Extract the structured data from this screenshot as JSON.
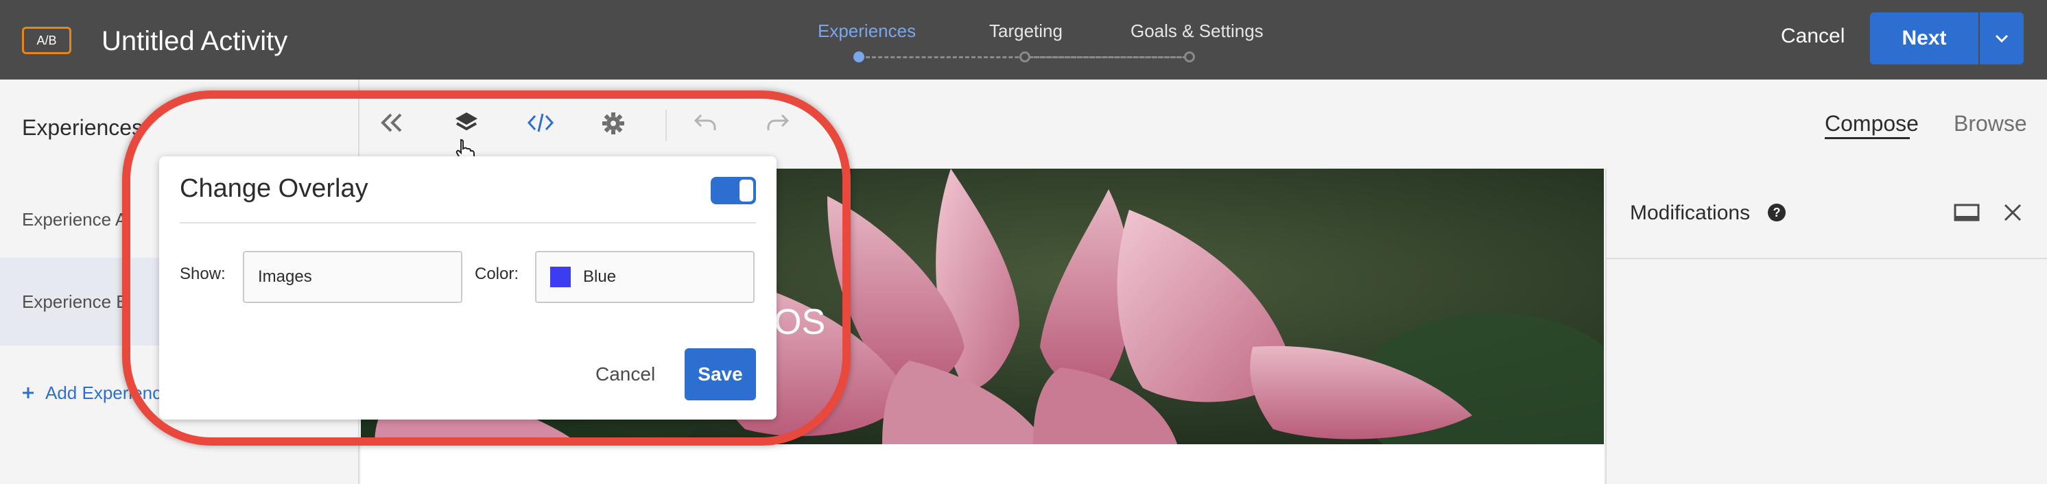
{
  "header": {
    "badge": "A/B",
    "title": "Untitled Activity",
    "steps": [
      {
        "label": "Experiences",
        "active": true
      },
      {
        "label": "Targeting",
        "active": false
      },
      {
        "label": "Goals & Settings",
        "active": false
      }
    ],
    "cancel_label": "Cancel",
    "next_label": "Next"
  },
  "sidebar": {
    "title": "Experiences",
    "items": [
      {
        "label": "Experience A",
        "selected": false
      },
      {
        "label": "Experience B",
        "selected": true
      }
    ],
    "add_label": "Add Experience"
  },
  "toolbar": {
    "icons": [
      "collapse-icon",
      "layers-icon",
      "code-icon",
      "gear-icon",
      "undo-icon",
      "redo-icon"
    ]
  },
  "view_tabs": {
    "compose_label": "Compose",
    "browse_label": "Browse",
    "active": "Compose"
  },
  "canvas": {
    "hero_text": "OS"
  },
  "modifications": {
    "title": "Modifications"
  },
  "overlay_popover": {
    "title": "Change Overlay",
    "toggle_on": true,
    "show_label": "Show:",
    "show_value": "Images",
    "color_label": "Color:",
    "color_value": "Blue",
    "color_swatch": "#3c3cf0",
    "cancel_label": "Cancel",
    "save_label": "Save"
  },
  "colors": {
    "accent": "#2c6fd1",
    "highlight": "#e9493c",
    "badge": "#e68619",
    "header_bg": "#4b4b4b"
  }
}
